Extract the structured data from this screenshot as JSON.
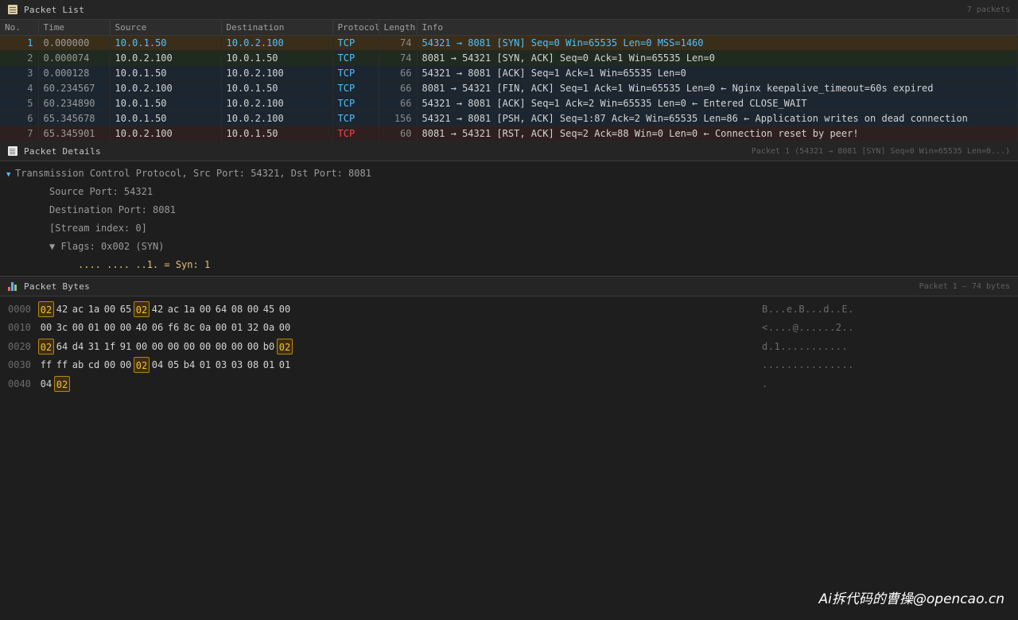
{
  "packet_list": {
    "title": "Packet List",
    "count": "7 packets",
    "columns": [
      "No.",
      "Time",
      "Source",
      "Destination",
      "Protocol",
      "Length",
      "Info"
    ],
    "rows": [
      {
        "no": "1",
        "time": "0.000000",
        "src": "10.0.1.50",
        "dst": "10.0.2.100",
        "proto": "TCP",
        "len": "74",
        "info": "54321 → 8081 [SYN] Seq=0 Win=65535 Len=0 MSS=1460",
        "style": "syn"
      },
      {
        "no": "2",
        "time": "0.000074",
        "src": "10.0.2.100",
        "dst": "10.0.1.50",
        "proto": "TCP",
        "len": "74",
        "info": "8081 → 54321 [SYN, ACK] Seq=0 Ack=1 Win=65535 Len=0",
        "style": "synack"
      },
      {
        "no": "3",
        "time": "0.000128",
        "src": "10.0.1.50",
        "dst": "10.0.2.100",
        "proto": "TCP",
        "len": "66",
        "info": "54321 → 8081 [ACK] Seq=1 Ack=1 Win=65535 Len=0",
        "style": "ack"
      },
      {
        "no": "4",
        "time": "60.234567",
        "src": "10.0.2.100",
        "dst": "10.0.1.50",
        "proto": "TCP",
        "len": "66",
        "info": "8081 → 54321 [FIN, ACK] Seq=1 Ack=1 Win=65535 Len=0 ← Nginx keepalive_timeout=60s expired",
        "style": "ack"
      },
      {
        "no": "5",
        "time": "60.234890",
        "src": "10.0.1.50",
        "dst": "10.0.2.100",
        "proto": "TCP",
        "len": "66",
        "info": "54321 → 8081 [ACK] Seq=1 Ack=2 Win=65535 Len=0 ← Entered CLOSE_WAIT",
        "style": "ack"
      },
      {
        "no": "6",
        "time": "65.345678",
        "src": "10.0.1.50",
        "dst": "10.0.2.100",
        "proto": "TCP",
        "len": "156",
        "info": "54321 → 8081 [PSH, ACK] Seq=1:87 Ack=2 Win=65535 Len=86 ← Application writes on dead connection",
        "style": "ack"
      },
      {
        "no": "7",
        "time": "65.345901",
        "src": "10.0.2.100",
        "dst": "10.0.1.50",
        "proto": "TCP",
        "len": "60",
        "info": "8081 → 54321 [RST, ACK] Seq=2 Ack=88 Win=0 Len=0 ← Connection reset by peer!",
        "style": "rst"
      }
    ]
  },
  "packet_details": {
    "title": "Packet Details",
    "summary": "Packet 1 (54321 → 8081 [SYN] Seq=0 Win=65535 Len=0...)",
    "lines": [
      {
        "text": "Transmission Control Protocol, Src Port: 54321, Dst Port: 8081",
        "level": 0,
        "expanded": true
      },
      {
        "text": "Source Port: 54321",
        "level": 1
      },
      {
        "text": "Destination Port: 8081",
        "level": 1
      },
      {
        "text": "[Stream index: 0]",
        "level": 1
      },
      {
        "text": "▼ Flags: 0x002 (SYN)",
        "level": 1
      },
      {
        "text": ".... .... ..1. = Syn: 1",
        "level": 2
      }
    ]
  },
  "packet_bytes": {
    "title": "Packet Bytes",
    "summary": "Packet 1 — 74 bytes",
    "rows": [
      {
        "offset": "0000",
        "hex": [
          "02",
          "42",
          "ac",
          "1a",
          "00",
          "65",
          "02",
          "42",
          "ac",
          "1a",
          "00",
          "64",
          "08",
          "00",
          "45",
          "00"
        ],
        "highlight": [
          0,
          6
        ],
        "ascii": "B...e.B...d..E."
      },
      {
        "offset": "0010",
        "hex": [
          "00",
          "3c",
          "00",
          "01",
          "00",
          "00",
          "40",
          "06",
          "f6",
          "8c",
          "0a",
          "00",
          "01",
          "32",
          "0a",
          "00"
        ],
        "highlight": [],
        "ascii": "<....@......2.."
      },
      {
        "offset": "0020",
        "hex": [
          "02",
          "64",
          "d4",
          "31",
          "1f",
          "91",
          "00",
          "00",
          "00",
          "00",
          "00",
          "00",
          "00",
          "00",
          "b0",
          "02"
        ],
        "highlight": [
          0,
          15
        ],
        "ascii": "d.1..........."
      },
      {
        "offset": "0030",
        "hex": [
          "ff",
          "ff",
          "ab",
          "cd",
          "00",
          "00",
          "02",
          "04",
          "05",
          "b4",
          "01",
          "03",
          "03",
          "08",
          "01",
          "01"
        ],
        "highlight": [
          6
        ],
        "ascii": "..............."
      },
      {
        "offset": "0040",
        "hex": [
          "04",
          "02"
        ],
        "highlight": [
          1
        ],
        "ascii": "."
      }
    ]
  },
  "watermark": "Ai拆代码的曹操@opencao.cn"
}
